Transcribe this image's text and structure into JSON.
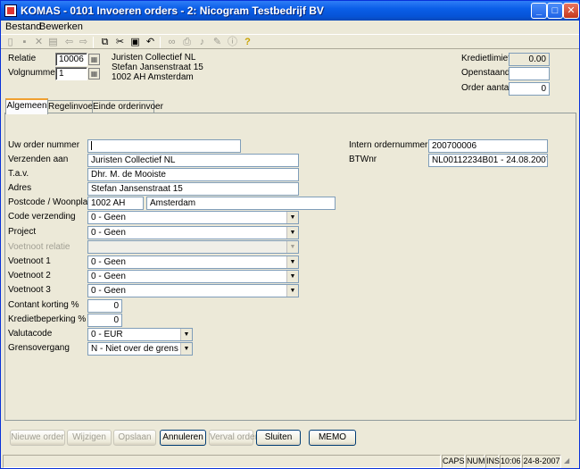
{
  "window": {
    "title": "KOMAS - 0101 Invoeren orders - 2: Nicogram Testbedrijf BV"
  },
  "menu": [
    "Bestand",
    "Bewerken"
  ],
  "header": {
    "relatie_label": "Relatie",
    "relatie_value": "10006",
    "volgnummer_label": "Volgnummer",
    "volgnummer_value": "1",
    "address_lines": [
      "Juristen Collectief NL",
      "Stefan Jansenstraat 15",
      "1002 AH Amsterdam"
    ],
    "kredietlimiet_label": "Kredietlimiet",
    "kredietlimiet_value": "0.00",
    "openstaand_label": "Openstaand",
    "openstaand_value": "",
    "order_aantal_label": "Order aantal",
    "order_aantal_value": "0"
  },
  "tabs": [
    {
      "label": "Algemeen",
      "active": true
    },
    {
      "label": "Regelinvoer",
      "active": false
    },
    {
      "label": "Einde orderinvoer",
      "active": false
    }
  ],
  "form": {
    "uw_order_nummer": {
      "label": "Uw order nummer",
      "value": ""
    },
    "verzenden_aan": {
      "label": "Verzenden aan",
      "value": "Juristen Collectief NL"
    },
    "tav": {
      "label": "T.a.v.",
      "value": "Dhr. M. de Mooiste"
    },
    "adres": {
      "label": "Adres",
      "value": "Stefan Jansenstraat 15"
    },
    "postcode": {
      "label": "Postcode / Woonplaats",
      "postcode": "1002 AH",
      "woonplaats": "Amsterdam"
    },
    "code_verzending": {
      "label": "Code verzending",
      "value": "0 - Geen"
    },
    "project": {
      "label": "Project",
      "value": "0 - Geen"
    },
    "voetnoot_relatie": {
      "label": "Voetnoot relatie",
      "value": ""
    },
    "voetnoot1": {
      "label": "Voetnoot 1",
      "value": "0 - Geen"
    },
    "voetnoot2": {
      "label": "Voetnoot 2",
      "value": "0 - Geen"
    },
    "voetnoot3": {
      "label": "Voetnoot 3",
      "value": "0 - Geen"
    },
    "contant_korting": {
      "label": "Contant korting %",
      "value": "0"
    },
    "kredietbeperking": {
      "label": "Kredietbeperking %",
      "value": "0"
    },
    "valutacode": {
      "label": "Valutacode",
      "value": "0 - EUR"
    },
    "grensovergang": {
      "label": "Grensovergang",
      "value": "N - Niet over de grens"
    },
    "intern_ordernummer": {
      "label": "Intern ordernummer",
      "value": "200700006"
    },
    "btwnr": {
      "label": "BTWnr",
      "value": "NL00112234B01 - 24.08.2007"
    }
  },
  "buttons": {
    "nieuwe_order": "Nieuwe order",
    "wijzigen": "Wijzigen",
    "opslaan": "Opslaan",
    "annuleren": "Annuleren",
    "verval_order": "Verval order",
    "sluiten": "Sluiten",
    "memo": "MEMO"
  },
  "status": {
    "caps": "CAPS",
    "num": "NUM",
    "ins": "INS",
    "time": "10:06",
    "date": "24-8-2007"
  },
  "colors": {
    "titlebar": "#0a5ee8",
    "window_bg": "#ece9d8",
    "tab_accent": "#f0a030"
  }
}
